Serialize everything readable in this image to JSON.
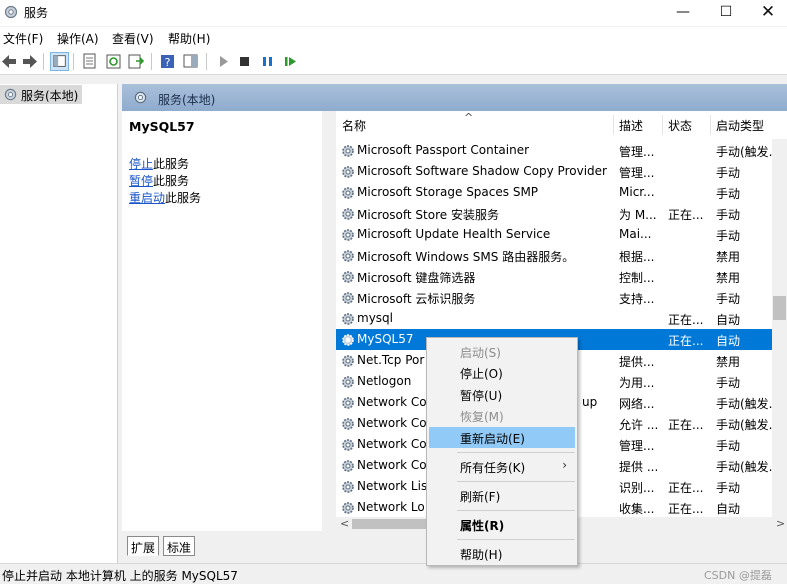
{
  "window": {
    "title": "服务",
    "min": "—",
    "max": "☐",
    "close": "✕"
  },
  "menubar": [
    "文件(F)",
    "操作(A)",
    "查看(V)",
    "帮助(H)"
  ],
  "tree": {
    "root": "服务(本地)"
  },
  "panel": {
    "header": "服务(本地)"
  },
  "detail": {
    "service_name": "MySQL57",
    "actions": [
      {
        "link": "停止",
        "rest": "此服务"
      },
      {
        "link": "暂停",
        "rest": "此服务"
      },
      {
        "link": "重启动",
        "rest": "此服务"
      }
    ]
  },
  "columns": {
    "name": "名称",
    "desc": "描述",
    "status": "状态",
    "startup": "启动类型"
  },
  "rows": [
    {
      "name": "Microsoft Passport Container",
      "desc": "管理...",
      "status": "",
      "startup": "手动(触发..."
    },
    {
      "name": "Microsoft Software Shadow Copy Provider",
      "desc": "管理...",
      "status": "",
      "startup": "手动"
    },
    {
      "name": "Microsoft Storage Spaces SMP",
      "desc": "Micr...",
      "status": "",
      "startup": "手动"
    },
    {
      "name": "Microsoft Store 安装服务",
      "desc": "为 M...",
      "status": "正在...",
      "startup": "手动"
    },
    {
      "name": "Microsoft Update Health Service",
      "desc": "Mai...",
      "status": "",
      "startup": "手动"
    },
    {
      "name": "Microsoft Windows SMS 路由器服务。",
      "desc": "根据...",
      "status": "",
      "startup": "禁用"
    },
    {
      "name": "Microsoft 键盘筛选器",
      "desc": "控制...",
      "status": "",
      "startup": "禁用"
    },
    {
      "name": "Microsoft 云标识服务",
      "desc": "支持...",
      "status": "",
      "startup": "手动"
    },
    {
      "name": "mysql",
      "desc": "",
      "status": "正在...",
      "startup": "自动"
    },
    {
      "name": "MySQL57",
      "desc": "",
      "status": "正在...",
      "startup": "自动"
    },
    {
      "name": "Net.Tcp Por",
      "desc": "提供...",
      "status": "",
      "startup": "禁用"
    },
    {
      "name": "Netlogon",
      "desc": "为用...",
      "status": "",
      "startup": "手动"
    },
    {
      "name": "Network Co",
      "desc": "网络...",
      "status": "",
      "startup": "手动(触发...",
      "extra": "up"
    },
    {
      "name": "Network Co",
      "desc": "允许 ...",
      "status": "正在...",
      "startup": "手动(触发..."
    },
    {
      "name": "Network Co",
      "desc": "管理...",
      "status": "",
      "startup": "手动"
    },
    {
      "name": "Network Co",
      "desc": "提供 ...",
      "status": "",
      "startup": "手动(触发..."
    },
    {
      "name": "Network Lis",
      "desc": "识别...",
      "status": "正在...",
      "startup": "手动"
    },
    {
      "name": "Network Lo",
      "desc": "收集...",
      "status": "正在...",
      "startup": "自动"
    }
  ],
  "context_menu": {
    "start": "启动(S)",
    "stop": "停止(O)",
    "pause": "暂停(U)",
    "resume": "恢复(M)",
    "restart": "重新启动(E)",
    "all_tasks": "所有任务(K)",
    "refresh": "刷新(F)",
    "properties": "属性(R)",
    "help": "帮助(H)"
  },
  "tabs": [
    "扩展",
    "标准"
  ],
  "status_text": "停止并启动 本地计算机 上的服务 MySQL57",
  "watermark": "CSDN @提磊",
  "colors": {
    "selection": "#0078d7",
    "menu_highlight": "#91c9f7",
    "link": "#1a55c9",
    "panel_header": "#9fb8d6"
  }
}
